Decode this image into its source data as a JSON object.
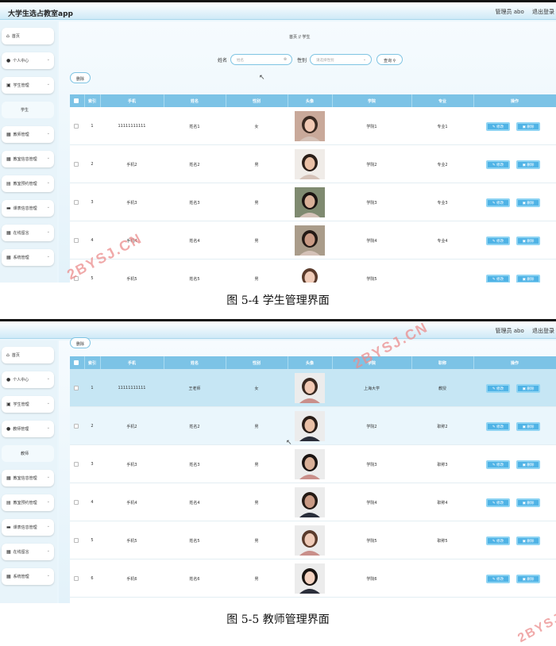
{
  "app_title": "大学生选占教室app",
  "top_user": "管理员 abo",
  "top_logout": "退出登录",
  "captions": [
    "图 5-4 学生管理界面",
    "图 5-5 教师管理界面"
  ],
  "watermark": "2BYSJ.CN",
  "shot1": {
    "sidebar": [
      {
        "icon": "home",
        "label": "首页",
        "chev": false
      },
      {
        "icon": "person",
        "label": "个人中心",
        "chev": true
      },
      {
        "icon": "briefcase",
        "label": "学生管理",
        "chev": true
      },
      {
        "icon": "none",
        "label": "学生",
        "chev": false,
        "sub": true
      },
      {
        "icon": "grid",
        "label": "教师管理",
        "chev": true
      },
      {
        "icon": "grid",
        "label": "教室信息管理",
        "chev": true
      },
      {
        "icon": "calendar",
        "label": "教室预约管理",
        "chev": true
      },
      {
        "icon": "card",
        "label": "课表信息管理",
        "chev": true
      },
      {
        "icon": "grid",
        "label": "在线留言",
        "chev": true
      },
      {
        "icon": "grid",
        "label": "系统管理",
        "chev": true
      }
    ],
    "breadcrumb": "首页 // 学生",
    "search": {
      "name_label": "姓名",
      "name_placeholder": "姓名",
      "gender_label": "性别",
      "gender_placeholder": "请选择性别",
      "query_label": "查询"
    },
    "delete_label": "删除",
    "headers": [
      "",
      "索引",
      "手机",
      "姓名",
      "性别",
      "头像",
      "学院",
      "专业",
      "操作"
    ],
    "edit_label": "修改",
    "del_label": "删除",
    "rows": [
      {
        "idx": "1",
        "phone": "11111111111",
        "name": "姓名1",
        "gender": "女",
        "college": "学院1",
        "major": "专业1"
      },
      {
        "idx": "2",
        "phone": "手机2",
        "name": "姓名2",
        "gender": "男",
        "college": "学院2",
        "major": "专业2"
      },
      {
        "idx": "3",
        "phone": "手机3",
        "name": "姓名3",
        "gender": "男",
        "college": "学院3",
        "major": "专业3"
      },
      {
        "idx": "4",
        "phone": "手机4",
        "name": "姓名4",
        "gender": "男",
        "college": "学院4",
        "major": "专业4"
      },
      {
        "idx": "5",
        "phone": "手机5",
        "name": "姓名5",
        "gender": "男",
        "college": "学院5",
        "major": ""
      }
    ]
  },
  "shot2": {
    "sidebar": [
      {
        "icon": "home",
        "label": "首页",
        "chev": false
      },
      {
        "icon": "person",
        "label": "个人中心",
        "chev": true
      },
      {
        "icon": "briefcase",
        "label": "学生管理",
        "chev": true
      },
      {
        "icon": "person",
        "label": "教师管理",
        "chev": true
      },
      {
        "icon": "none",
        "label": "教师",
        "chev": false,
        "sub": true
      },
      {
        "icon": "grid",
        "label": "教室信息管理",
        "chev": true
      },
      {
        "icon": "calendar",
        "label": "教室预约管理",
        "chev": true
      },
      {
        "icon": "card",
        "label": "课表信息管理",
        "chev": true
      },
      {
        "icon": "grid",
        "label": "在线留言",
        "chev": true
      },
      {
        "icon": "grid",
        "label": "系统管理",
        "chev": true
      }
    ],
    "delete_label": "删除",
    "headers": [
      "",
      "索引",
      "手机",
      "姓名",
      "性别",
      "头像",
      "学院",
      "职称",
      "操作"
    ],
    "edit_label": "修改",
    "del_label": "删除",
    "rows": [
      {
        "idx": "1",
        "phone": "11111111111",
        "name": "王老师",
        "gender": "女",
        "college": "上海大学",
        "major": "教授"
      },
      {
        "idx": "2",
        "phone": "手机2",
        "name": "姓名2",
        "gender": "男",
        "college": "学院2",
        "major": "职称2"
      },
      {
        "idx": "3",
        "phone": "手机3",
        "name": "姓名3",
        "gender": "男",
        "college": "学院3",
        "major": "职称3"
      },
      {
        "idx": "4",
        "phone": "手机4",
        "name": "姓名4",
        "gender": "男",
        "college": "学院4",
        "major": "职称4"
      },
      {
        "idx": "5",
        "phone": "手机5",
        "name": "姓名5",
        "gender": "男",
        "college": "学院5",
        "major": "职称5"
      },
      {
        "idx": "6",
        "phone": "手机6",
        "name": "姓名6",
        "gender": "男",
        "college": "学院6",
        "major": ""
      }
    ]
  }
}
